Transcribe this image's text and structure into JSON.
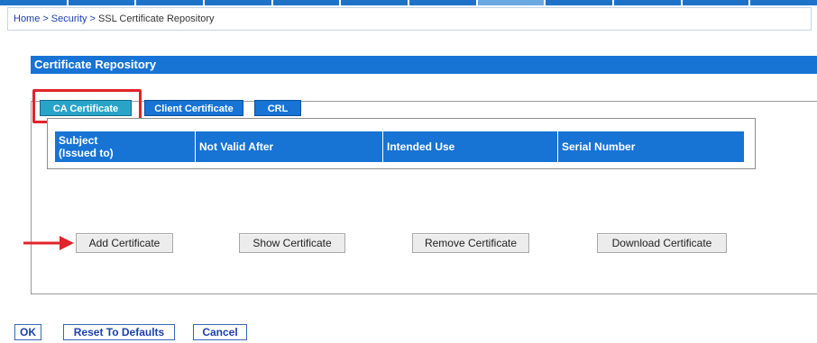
{
  "breadcrumb": {
    "home": "Home",
    "security": "Security",
    "current": "SSL Certificate Repository",
    "separator": ">"
  },
  "section": {
    "title": "Certificate Repository"
  },
  "tabs": [
    {
      "label": "CA Certificate",
      "selected": true
    },
    {
      "label": "Client Certificate",
      "selected": false
    },
    {
      "label": "CRL",
      "selected": false
    }
  ],
  "table": {
    "columns": [
      "Subject\n(Issued to)",
      "Not Valid After",
      "Intended Use",
      "Serial Number"
    ],
    "rows": []
  },
  "actions": {
    "add": "Add Certificate",
    "show": "Show Certificate",
    "remove": "Remove Certificate",
    "download": "Download Certificate"
  },
  "footer": {
    "ok": "OK",
    "reset": "Reset To Defaults",
    "cancel": "Cancel"
  },
  "colors": {
    "accent": "#1773d4",
    "selected_tab": "#2aa3c8",
    "annotation": "#e0242b"
  }
}
